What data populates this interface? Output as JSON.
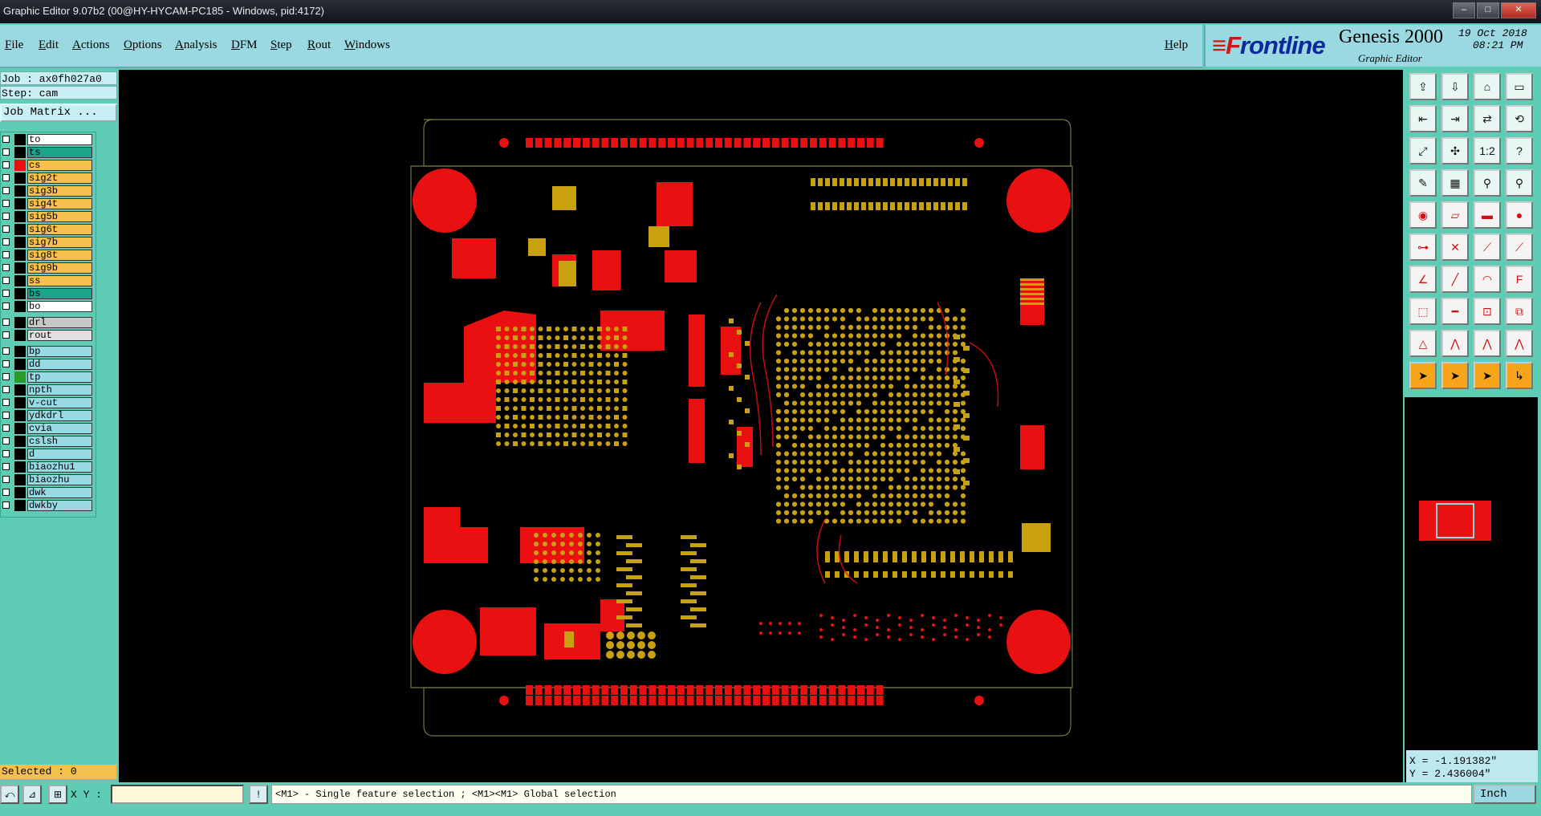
{
  "window": {
    "title": "Graphic Editor 9.07b2 (00@HY-HYCAM-PC185 - Windows, pid:4172)",
    "minimize": "‒",
    "maximize": "□",
    "close": "✕"
  },
  "menu": [
    "File",
    "Edit",
    "Actions",
    "Options",
    "Analysis",
    "DFM",
    "Step",
    "Rout",
    "Windows"
  ],
  "help": "Help",
  "brand": {
    "logo_mark": "≡F",
    "logo_text": "rontline",
    "product": "Genesis 2000",
    "subtitle": "Graphic Editor",
    "date": "19 Oct 2018",
    "time": "08:21 PM"
  },
  "job": {
    "job_label": "Job : ax0fh027a0",
    "step_label": "Step: cam",
    "matrix_button": "Job Matrix ..."
  },
  "layers": [
    {
      "name": "to",
      "color": "#ffffff",
      "swatch": "#000000"
    },
    {
      "name": "ts",
      "color": "#1aa58a",
      "swatch": "#000000"
    },
    {
      "name": "cs",
      "color": "#f6c14a",
      "swatch": "#e81010"
    },
    {
      "name": "sig2t",
      "color": "#f6c14a",
      "swatch": "#000000"
    },
    {
      "name": "sig3b",
      "color": "#f6c14a",
      "swatch": "#000000"
    },
    {
      "name": "sig4t",
      "color": "#f6c14a",
      "swatch": "#000000"
    },
    {
      "name": "sig5b",
      "color": "#f6c14a",
      "swatch": "#000000"
    },
    {
      "name": "sig6t",
      "color": "#f6c14a",
      "swatch": "#000000"
    },
    {
      "name": "sig7b",
      "color": "#f6c14a",
      "swatch": "#000000"
    },
    {
      "name": "sig8t",
      "color": "#f6c14a",
      "swatch": "#000000"
    },
    {
      "name": "sig9b",
      "color": "#f6c14a",
      "swatch": "#000000"
    },
    {
      "name": "ss",
      "color": "#f6c14a",
      "swatch": "#000000"
    },
    {
      "name": "bs",
      "color": "#1aa58a",
      "swatch": "#000000"
    },
    {
      "name": "bo",
      "color": "#ffffff",
      "swatch": "#000000"
    },
    {
      "name": "drl",
      "color": "#c8c8c8",
      "swatch": "#000000"
    },
    {
      "name": "rout",
      "color": "#e0e0e0",
      "swatch": "#000000"
    },
    {
      "name": "bp",
      "color": "#9ad9e2",
      "swatch": "#000000"
    },
    {
      "name": "dd",
      "color": "#9ad9e2",
      "swatch": "#000000"
    },
    {
      "name": "tp",
      "color": "#9ad9e2",
      "swatch": "#2a9a2a"
    },
    {
      "name": "npth",
      "color": "#9ad9e2",
      "swatch": "#000000"
    },
    {
      "name": "v-cut",
      "color": "#9ad9e2",
      "swatch": "#000000"
    },
    {
      "name": "ydkdrl",
      "color": "#9ad9e2",
      "swatch": "#000000"
    },
    {
      "name": "cvia",
      "color": "#9ad9e2",
      "swatch": "#000000"
    },
    {
      "name": "cslsh",
      "color": "#9ad9e2",
      "swatch": "#000000"
    },
    {
      "name": "d",
      "color": "#9ad9e2",
      "swatch": "#000000"
    },
    {
      "name": "biaozhu1",
      "color": "#9ad9e2",
      "swatch": "#000000"
    },
    {
      "name": "biaozhu",
      "color": "#9ad9e2",
      "swatch": "#000000"
    },
    {
      "name": "dwk",
      "color": "#9ad9e2",
      "swatch": "#000000"
    },
    {
      "name": "dwkby",
      "color": "#9ad9e2",
      "swatch": "#000000"
    }
  ],
  "selected": "Selected : 0",
  "toolbar": [
    {
      "name": "open-job-icon",
      "glyph": "⇪"
    },
    {
      "name": "save-icon",
      "glyph": "⇩"
    },
    {
      "name": "home-icon",
      "glyph": "⌂"
    },
    {
      "name": "window-icon",
      "glyph": "▭"
    },
    {
      "name": "pan-left-icon",
      "glyph": "⇤"
    },
    {
      "name": "pan-right-icon",
      "glyph": "⇥"
    },
    {
      "name": "swap-icon",
      "glyph": "⇄"
    },
    {
      "name": "loop-icon",
      "glyph": "⟲"
    },
    {
      "name": "zoom-fit-icon",
      "glyph": "⤢"
    },
    {
      "name": "zoom-center-icon",
      "glyph": "✣"
    },
    {
      "name": "scale-1to2-icon",
      "glyph": "1:2"
    },
    {
      "name": "help-icon",
      "glyph": "?"
    },
    {
      "name": "measure-icon",
      "glyph": "✎"
    },
    {
      "name": "grid-icon",
      "glyph": "▦"
    },
    {
      "name": "snap-red-icon",
      "glyph": "⚲"
    },
    {
      "name": "snap-red2-icon",
      "glyph": "⚲"
    },
    {
      "name": "add-pad-icon",
      "glyph": "◉"
    },
    {
      "name": "edit-shape-icon",
      "glyph": "▱"
    },
    {
      "name": "line-icon",
      "glyph": "▬"
    },
    {
      "name": "pad-icon",
      "glyph": "●"
    },
    {
      "name": "connect-icon",
      "glyph": "⊶"
    },
    {
      "name": "cross-icon",
      "glyph": "✕"
    },
    {
      "name": "route-icon",
      "glyph": "⟋"
    },
    {
      "name": "slash-icon",
      "glyph": "⟋"
    },
    {
      "name": "angle-icon",
      "glyph": "∠"
    },
    {
      "name": "diagonal-icon",
      "glyph": "╱"
    },
    {
      "name": "arc-icon",
      "glyph": "◠"
    },
    {
      "name": "text-icon",
      "glyph": "F"
    },
    {
      "name": "pad-move-icon",
      "glyph": "⬚"
    },
    {
      "name": "minus-icon",
      "glyph": "━"
    },
    {
      "name": "bracket-icon",
      "glyph": "⊡"
    },
    {
      "name": "dual-icon",
      "glyph": "⧉"
    },
    {
      "name": "triangle-icon",
      "glyph": "△"
    },
    {
      "name": "arch-icon",
      "glyph": "⋀"
    },
    {
      "name": "arch2-icon",
      "glyph": "⋀"
    },
    {
      "name": "arch3-icon",
      "glyph": "⋀"
    },
    {
      "name": "select-arrow-icon",
      "glyph": "➤"
    },
    {
      "name": "select-arrow2-icon",
      "glyph": "➤"
    },
    {
      "name": "select-arrow3-icon",
      "glyph": "➤"
    },
    {
      "name": "select-net-icon",
      "glyph": "↳"
    }
  ],
  "coords": {
    "x": "X = -1.191382\"",
    "y": "Y = 2.436004\""
  },
  "status": {
    "xy_label": "X Y :",
    "xy_value": "",
    "message": "<M1> - Single feature selection ; <M1><M1> Global selection",
    "unit": "Inch"
  }
}
